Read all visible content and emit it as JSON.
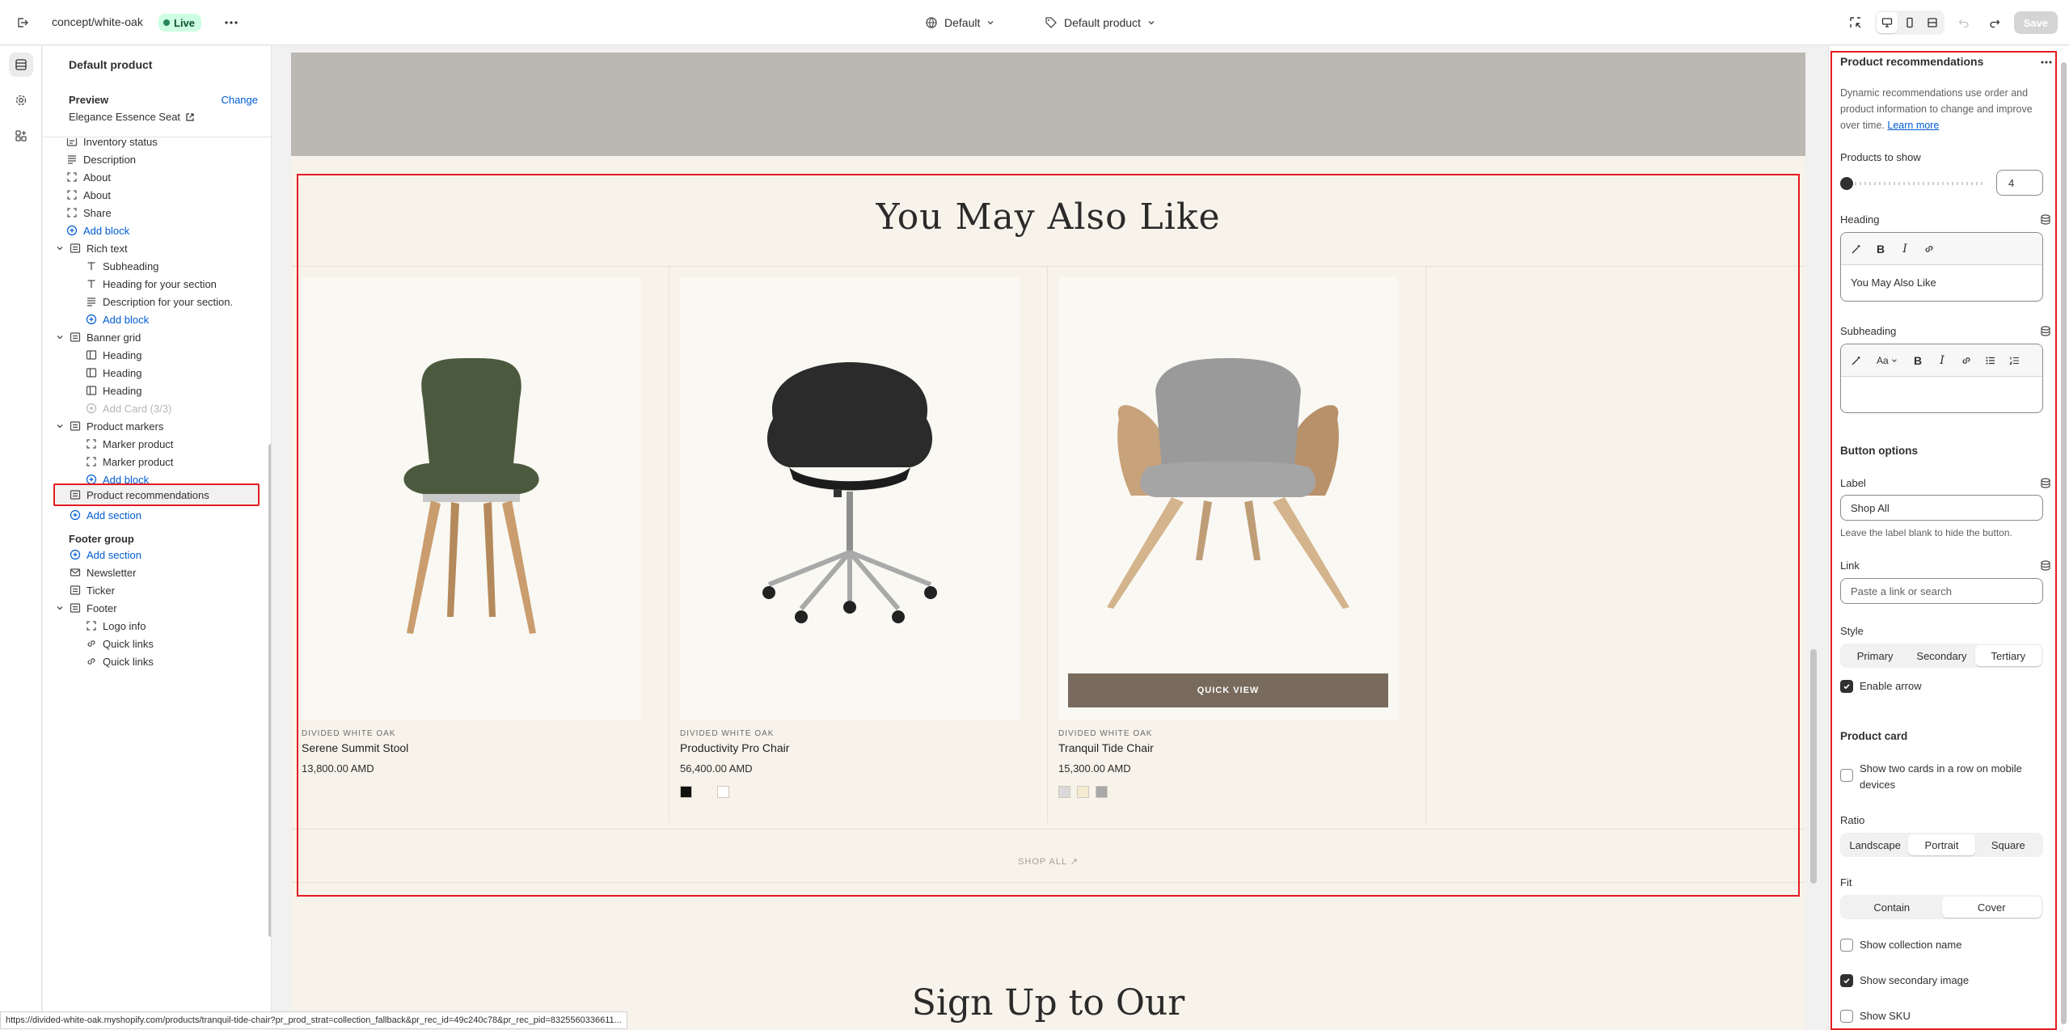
{
  "topbar": {
    "store_name": "concept/white-oak",
    "status_badge": "Live",
    "theme_selector": "Default",
    "template_selector": "Default product",
    "save_label": "Save"
  },
  "sidebar": {
    "title": "Default product",
    "preview_label": "Preview",
    "change_label": "Change",
    "preview_product": "Elegance Essence Seat",
    "tree": {
      "inventory_status": "Inventory status",
      "description": "Description",
      "about_1": "About",
      "about_2": "About",
      "share": "Share",
      "add_block_1": "Add block",
      "rich_text": "Rich text",
      "subheading": "Subheading",
      "heading_for_section": "Heading for your section",
      "description_for_section": "Description for your section.",
      "add_block_2": "Add block",
      "banner_grid": "Banner grid",
      "heading_1": "Heading",
      "heading_2": "Heading",
      "heading_3": "Heading",
      "add_card": "Add Card (3/3)",
      "product_markers": "Product markers",
      "marker_product_1": "Marker product",
      "marker_product_2": "Marker product",
      "add_block_3": "Add block",
      "product_recommendations": "Product recommendations",
      "add_section_1": "Add section",
      "footer_group": "Footer group",
      "add_section_2": "Add section",
      "newsletter": "Newsletter",
      "ticker": "Ticker",
      "footer": "Footer",
      "logo_info": "Logo info",
      "quick_links_1": "Quick links",
      "quick_links_2": "Quick links"
    }
  },
  "preview": {
    "section_heading": "You May Also Like",
    "products": [
      {
        "vendor": "DIVIDED WHITE OAK",
        "name": "Serene Summit Stool",
        "price": "13,800.00 AMD",
        "swatches": []
      },
      {
        "vendor": "DIVIDED WHITE OAK",
        "name": "Productivity Pro Chair",
        "price": "56,400.00 AMD",
        "swatches": [
          "#111111",
          "#f7f3ea",
          "#ffffff"
        ]
      },
      {
        "vendor": "DIVIDED WHITE OAK",
        "name": "Tranquil Tide Chair",
        "price": "15,300.00 AMD",
        "swatches": [
          "#d9d9d9",
          "#f4ead2",
          "#a8a8a8"
        ]
      }
    ],
    "quick_view_label": "QUICK VIEW",
    "shop_all_label": "SHOP ALL ↗",
    "signup_heading": "Sign Up to Our",
    "status_url": "https://divided-white-oak.myshopify.com/products/tranquil-tide-chair?pr_prod_strat=collection_fallback&pr_rec_id=49c240c78&pr_rec_pid=8325560336611..."
  },
  "settings": {
    "title": "Product recommendations",
    "description": "Dynamic recommendations use order and product information to change and improve over time.",
    "learn_more": "Learn more",
    "products_to_show_label": "Products to show",
    "products_to_show_value": "4",
    "heading_label": "Heading",
    "heading_value": "You May Also Like",
    "subheading_label": "Subheading",
    "subheading_value": "",
    "font_size_label": "Aa",
    "button_options_title": "Button options",
    "button_label_label": "Label",
    "button_label_value": "Shop All",
    "button_label_hint": "Leave the label blank to hide the button.",
    "link_label": "Link",
    "link_placeholder": "Paste a link or search",
    "style_label": "Style",
    "style_options": [
      "Primary",
      "Secondary",
      "Tertiary"
    ],
    "style_selected": "Tertiary",
    "enable_arrow_label": "Enable arrow",
    "enable_arrow_checked": true,
    "product_card_title": "Product card",
    "two_cards_label": "Show two cards in a row on mobile devices",
    "two_cards_checked": false,
    "ratio_label": "Ratio",
    "ratio_options": [
      "Landscape",
      "Portrait",
      "Square"
    ],
    "ratio_selected": "Portrait",
    "fit_label": "Fit",
    "fit_options": [
      "Contain",
      "Cover"
    ],
    "fit_selected": "Cover",
    "show_collection_name_label": "Show collection name",
    "show_collection_name_checked": false,
    "show_secondary_image_label": "Show secondary image",
    "show_secondary_image_checked": true,
    "show_sku_label": "Show SKU",
    "show_sku_checked": false
  },
  "colors": {
    "accent_link": "#005bd3",
    "highlight_outline": "#e51c23",
    "live_badge_bg": "#cdfee1",
    "page_bg": "#f7f3ea",
    "quick_view_bg": "#786a5c"
  }
}
